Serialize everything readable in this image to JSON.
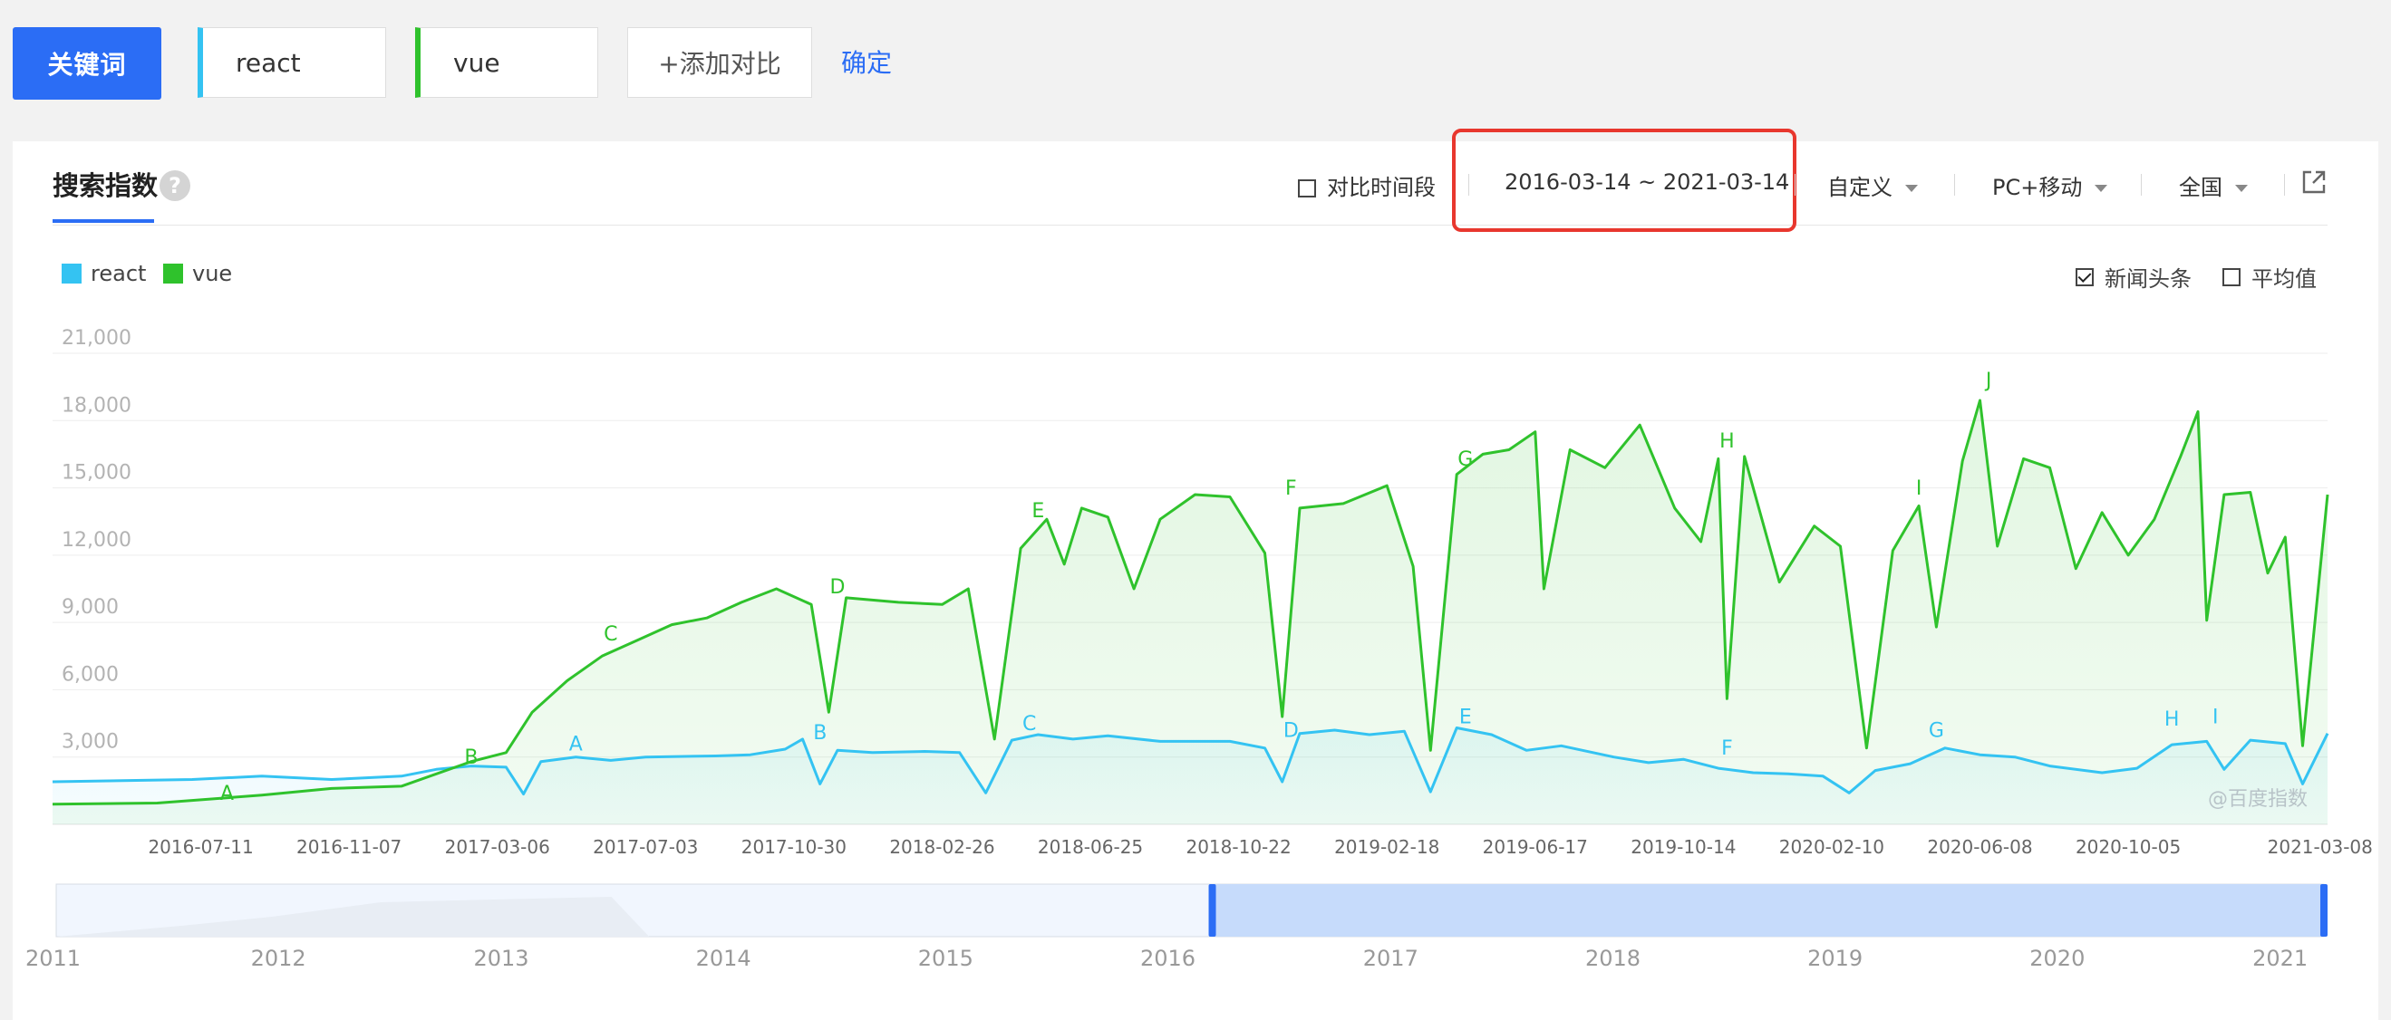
{
  "keywords": {
    "button_label": "关键词",
    "terms": [
      "react",
      "vue"
    ],
    "add_label": "+添加对比",
    "confirm_label": "确定"
  },
  "panel": {
    "tab_title": "搜索指数",
    "help": "?",
    "compare_period_label": "对比时间段",
    "date_range": "2016-03-14 ~ 2021-03-14",
    "custom_label": "自定义",
    "device_label": "PC+移动",
    "region_label": "全国",
    "news_label": "新闻头条",
    "average_label": "平均值",
    "watermark": "@百度指数"
  },
  "colors": {
    "react": "#34c3f2",
    "vue": "#2fc22c",
    "accent": "#2b6df5",
    "highlight_box": "#e8372e"
  },
  "chart_data": {
    "type": "line",
    "ylim": [
      0,
      21000
    ],
    "yticks": [
      "3,000",
      "6,000",
      "9,000",
      "12,000",
      "15,000",
      "18,000",
      "21,000"
    ],
    "xticks": [
      "2016-07-11",
      "2016-11-07",
      "2017-03-06",
      "2017-07-03",
      "2017-10-30",
      "2018-02-26",
      "2018-06-25",
      "2018-10-22",
      "2019-02-18",
      "2019-06-17",
      "2019-10-14",
      "2020-02-10",
      "2020-06-08",
      "2020-10-05",
      "2021-03-08"
    ],
    "grid": true,
    "legend": "top-left",
    "series": [
      {
        "name": "react",
        "color": "#34c3f2",
        "points": [
          [
            "2016-03-14",
            1900
          ],
          [
            "2016-05-09",
            1950
          ],
          [
            "2016-07-04",
            2000
          ],
          [
            "2016-08-29",
            2150
          ],
          [
            "2016-10-24",
            2000
          ],
          [
            "2016-12-19",
            2150
          ],
          [
            "2017-01-16",
            2450
          ],
          [
            "2017-02-13",
            2600
          ],
          [
            "2017-03-13",
            2550
          ],
          [
            "2017-03-27",
            1350
          ],
          [
            "2017-04-10",
            2800
          ],
          [
            "2017-05-08",
            3000
          ],
          [
            "2017-06-05",
            2850
          ],
          [
            "2017-07-03",
            3000
          ],
          [
            "2017-08-28",
            3050
          ],
          [
            "2017-09-25",
            3100
          ],
          [
            "2017-10-23",
            3350
          ],
          [
            "2017-11-06",
            3800
          ],
          [
            "2017-11-20",
            1800
          ],
          [
            "2017-12-04",
            3300
          ],
          [
            "2018-01-01",
            3200
          ],
          [
            "2018-02-12",
            3250
          ],
          [
            "2018-03-12",
            3200
          ],
          [
            "2018-04-02",
            1400
          ],
          [
            "2018-04-23",
            3750
          ],
          [
            "2018-05-14",
            4000
          ],
          [
            "2018-06-11",
            3800
          ],
          [
            "2018-07-09",
            3950
          ],
          [
            "2018-08-20",
            3700
          ],
          [
            "2018-10-15",
            3700
          ],
          [
            "2018-11-12",
            3400
          ],
          [
            "2018-11-26",
            1900
          ],
          [
            "2018-12-10",
            4050
          ],
          [
            "2019-01-07",
            4200
          ],
          [
            "2019-02-04",
            4000
          ],
          [
            "2019-03-04",
            4150
          ],
          [
            "2019-03-25",
            1450
          ],
          [
            "2019-04-15",
            4300
          ],
          [
            "2019-05-13",
            4000
          ],
          [
            "2019-06-10",
            3300
          ],
          [
            "2019-07-08",
            3500
          ],
          [
            "2019-08-19",
            3000
          ],
          [
            "2019-09-16",
            2750
          ],
          [
            "2019-10-14",
            2900
          ],
          [
            "2019-11-11",
            2500
          ],
          [
            "2019-12-09",
            2300
          ],
          [
            "2020-01-06",
            2250
          ],
          [
            "2020-02-03",
            2150
          ],
          [
            "2020-02-24",
            1400
          ],
          [
            "2020-03-16",
            2400
          ],
          [
            "2020-04-13",
            2700
          ],
          [
            "2020-05-11",
            3400
          ],
          [
            "2020-06-08",
            3100
          ],
          [
            "2020-07-06",
            3000
          ],
          [
            "2020-08-03",
            2600
          ],
          [
            "2020-09-14",
            2300
          ],
          [
            "2020-10-12",
            2500
          ],
          [
            "2020-11-09",
            3550
          ],
          [
            "2020-12-07",
            3700
          ],
          [
            "2020-12-21",
            2450
          ],
          [
            "2021-01-11",
            3750
          ],
          [
            "2021-02-08",
            3600
          ],
          [
            "2021-02-22",
            1800
          ],
          [
            "2021-03-14",
            4050
          ]
        ]
      },
      {
        "name": "vue",
        "color": "#2fc22c",
        "points": [
          [
            "2016-03-14",
            900
          ],
          [
            "2016-06-06",
            950
          ],
          [
            "2016-08-29",
            1300
          ],
          [
            "2016-10-24",
            1600
          ],
          [
            "2016-12-19",
            1700
          ],
          [
            "2017-02-13",
            2800
          ],
          [
            "2017-03-13",
            3200
          ],
          [
            "2017-04-03",
            5000
          ],
          [
            "2017-05-01",
            6400
          ],
          [
            "2017-05-29",
            7500
          ],
          [
            "2017-06-26",
            8200
          ],
          [
            "2017-07-24",
            8900
          ],
          [
            "2017-08-21",
            9200
          ],
          [
            "2017-09-18",
            9900
          ],
          [
            "2017-10-16",
            10500
          ],
          [
            "2017-11-13",
            9800
          ],
          [
            "2017-11-27",
            5000
          ],
          [
            "2017-12-11",
            10100
          ],
          [
            "2018-01-22",
            9900
          ],
          [
            "2018-02-26",
            9800
          ],
          [
            "2018-03-19",
            10500
          ],
          [
            "2018-04-09",
            3800
          ],
          [
            "2018-04-30",
            12300
          ],
          [
            "2018-05-21",
            13600
          ],
          [
            "2018-06-04",
            11600
          ],
          [
            "2018-06-18",
            14100
          ],
          [
            "2018-07-09",
            13700
          ],
          [
            "2018-07-30",
            10500
          ],
          [
            "2018-08-20",
            13600
          ],
          [
            "2018-09-17",
            14700
          ],
          [
            "2018-10-15",
            14600
          ],
          [
            "2018-11-12",
            12100
          ],
          [
            "2018-11-26",
            4800
          ],
          [
            "2018-12-10",
            14100
          ],
          [
            "2019-01-14",
            14300
          ],
          [
            "2019-02-18",
            15100
          ],
          [
            "2019-03-11",
            11500
          ],
          [
            "2019-03-25",
            3300
          ],
          [
            "2019-04-15",
            15600
          ],
          [
            "2019-05-06",
            16500
          ],
          [
            "2019-05-27",
            16700
          ],
          [
            "2019-06-17",
            17500
          ],
          [
            "2019-06-24",
            10500
          ],
          [
            "2019-07-15",
            16700
          ],
          [
            "2019-08-12",
            15900
          ],
          [
            "2019-09-09",
            17800
          ],
          [
            "2019-10-07",
            14100
          ],
          [
            "2019-10-28",
            12600
          ],
          [
            "2019-11-11",
            16300
          ],
          [
            "2019-11-18",
            5600
          ],
          [
            "2019-12-02",
            16400
          ],
          [
            "2019-12-30",
            10800
          ],
          [
            "2020-01-27",
            13300
          ],
          [
            "2020-02-17",
            12400
          ],
          [
            "2020-03-09",
            3400
          ],
          [
            "2020-03-30",
            12200
          ],
          [
            "2020-04-20",
            14200
          ],
          [
            "2020-05-04",
            8800
          ],
          [
            "2020-05-25",
            16200
          ],
          [
            "2020-06-08",
            18900
          ],
          [
            "2020-06-22",
            12400
          ],
          [
            "2020-07-13",
            16300
          ],
          [
            "2020-08-03",
            15900
          ],
          [
            "2020-08-24",
            11400
          ],
          [
            "2020-09-14",
            13900
          ],
          [
            "2020-10-05",
            12000
          ],
          [
            "2020-10-26",
            13600
          ],
          [
            "2020-11-16",
            16400
          ],
          [
            "2020-11-30",
            18400
          ],
          [
            "2020-12-07",
            9100
          ],
          [
            "2020-12-21",
            14700
          ],
          [
            "2021-01-11",
            14800
          ],
          [
            "2021-01-25",
            11200
          ],
          [
            "2021-02-08",
            12800
          ],
          [
            "2021-02-22",
            3500
          ],
          [
            "2021-03-14",
            14700
          ]
        ]
      }
    ],
    "annotations": {
      "vue": [
        [
          "A",
          "2016-08-01",
          1100
        ],
        [
          "B",
          "2017-02-13",
          2700
        ],
        [
          "C",
          "2017-06-05",
          8200
        ],
        [
          "D",
          "2017-12-04",
          10300
        ],
        [
          "E",
          "2018-05-14",
          13700
        ],
        [
          "F",
          "2018-12-03",
          14700
        ],
        [
          "G",
          "2019-04-22",
          16000
        ],
        [
          "H",
          "2019-11-18",
          16800
        ],
        [
          "I",
          "2020-04-20",
          14700
        ],
        [
          "J",
          "2020-06-15",
          19500
        ]
      ],
      "react": [
        [
          "A",
          "2017-05-08",
          3300
        ],
        [
          "B",
          "2017-11-20",
          3800
        ],
        [
          "C",
          "2018-05-07",
          4200
        ],
        [
          "D",
          "2018-12-03",
          3900
        ],
        [
          "E",
          "2019-04-22",
          4500
        ],
        [
          "F",
          "2019-11-18",
          3100
        ],
        [
          "G",
          "2020-05-04",
          3900
        ],
        [
          "H",
          "2020-11-09",
          4400
        ],
        [
          "I",
          "2020-12-14",
          4500
        ]
      ]
    },
    "navigator_ticks": [
      "2011",
      "2012",
      "2013",
      "2014",
      "2015",
      "2016",
      "2017",
      "2018",
      "2019",
      "2020",
      "2021"
    ],
    "navigator_selection": [
      "2016-03-14",
      "2021-03-14"
    ]
  }
}
